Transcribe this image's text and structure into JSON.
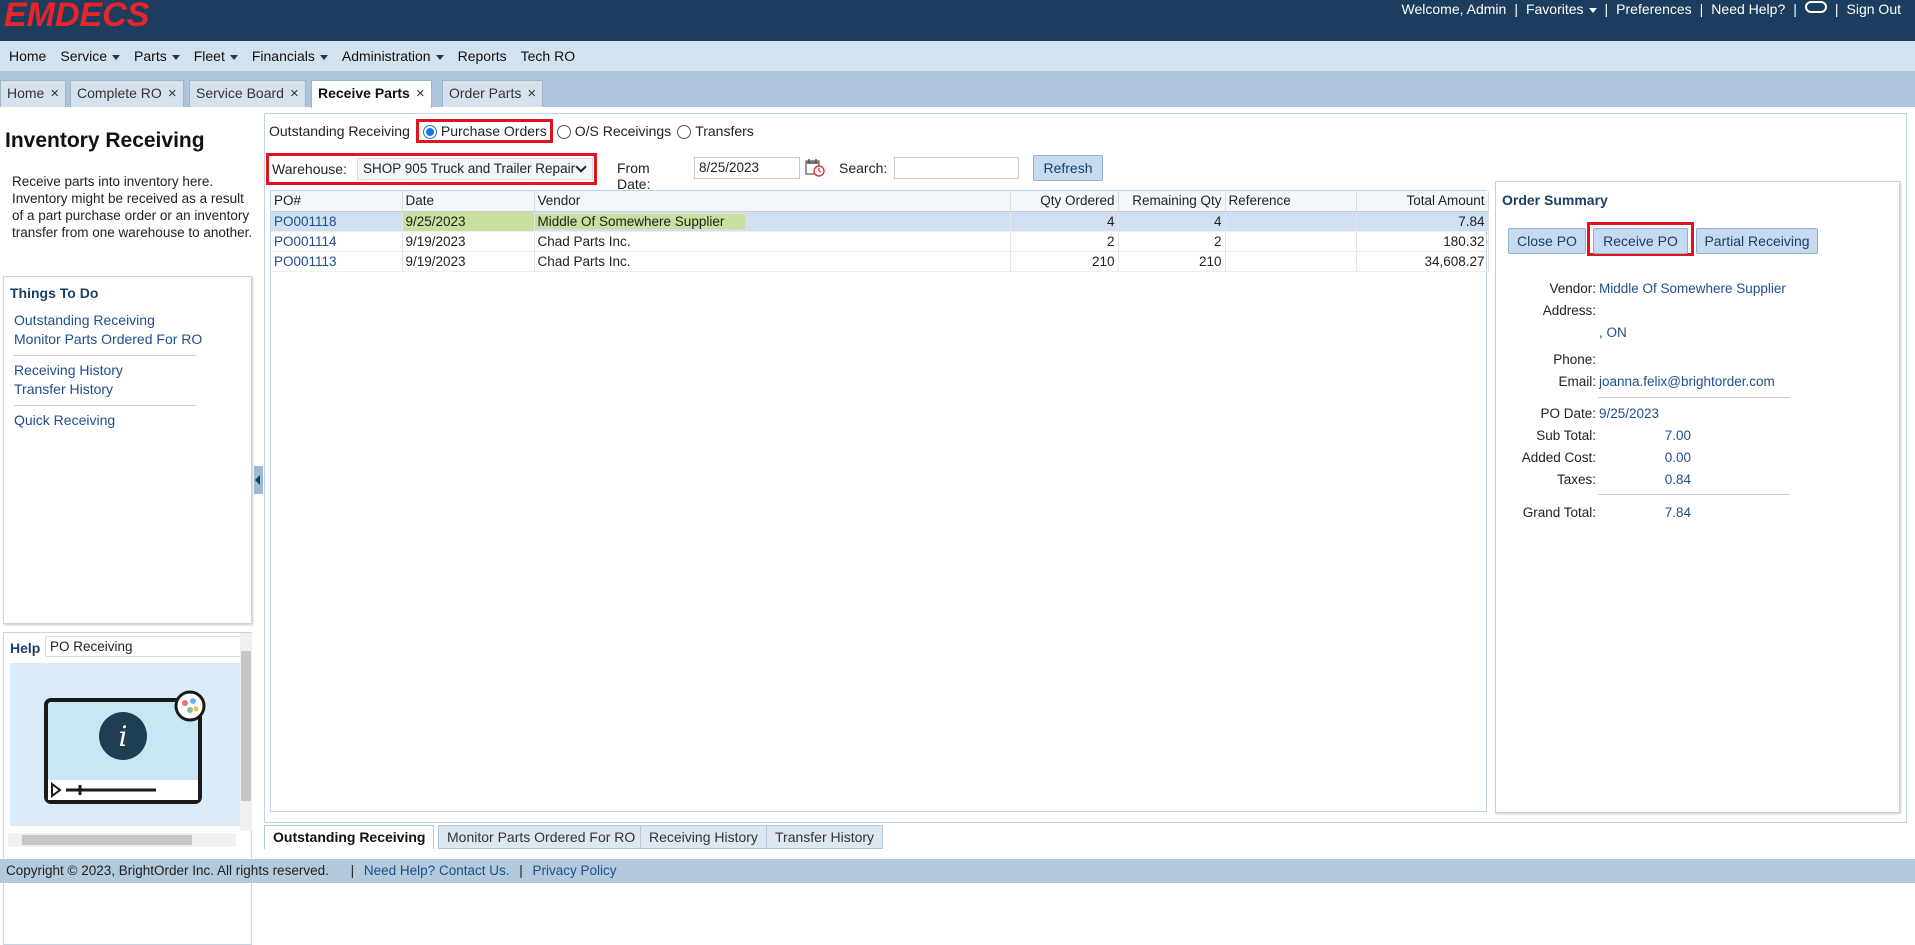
{
  "app": {
    "logo_text": "EMDECS",
    "brand_color": "#e8252b",
    "topbar_color": "#1d3d5f"
  },
  "top_nav": {
    "welcome": "Welcome, Admin",
    "favorites": "Favorites",
    "preferences": "Preferences",
    "need_help": "Need Help?",
    "sign_out": "Sign Out",
    "sep": "|"
  },
  "main_menu": {
    "home": "Home",
    "service": "Service",
    "parts": "Parts",
    "fleet": "Fleet",
    "financials": "Financials",
    "administration": "Administration",
    "reports": "Reports",
    "tech_ro": "Tech RO"
  },
  "tabs": [
    {
      "label": "Home"
    },
    {
      "label": "Complete RO"
    },
    {
      "label": "Service Board"
    },
    {
      "label": "Receive Parts"
    },
    {
      "label": "Order Parts"
    }
  ],
  "tab_close": "×",
  "sidebar": {
    "title": "Inventory Receiving",
    "description": "Receive parts into inventory here. Inventory might be received as a result of a part purchase order or an inventory transfer from one warehouse to another.",
    "todo_title": "Things To Do",
    "links": {
      "outstanding": "Outstanding Receiving",
      "monitor": "Monitor Parts Ordered For RO",
      "history": "Receiving History",
      "transfer": "Transfer History",
      "quick": "Quick Receiving"
    },
    "help_label": "Help",
    "help_topic": "PO Receiving"
  },
  "filters": {
    "outstanding_label": "Outstanding Receiving",
    "radio_po": "Purchase Orders",
    "radio_os": "O/S Receivings",
    "radio_transfers": "Transfers",
    "selected_radio": "Purchase Orders",
    "warehouse_label": "Warehouse:",
    "warehouse_value": "SHOP 905 Truck and Trailer Repair",
    "from_date_label": "From Date:",
    "from_date_value": "8/25/2023",
    "search_label": "Search:",
    "search_value": "",
    "refresh": "Refresh"
  },
  "grid": {
    "columns": {
      "po": "PO#",
      "date": "Date",
      "vendor": "Vendor",
      "qty_ordered": "Qty Ordered",
      "remaining_qty": "Remaining Qty",
      "reference": "Reference",
      "total_amount": "Total Amount"
    },
    "rows": [
      {
        "po": "PO001118",
        "date": "9/25/2023",
        "vendor": "Middle Of Somewhere Supplier",
        "qty_ordered": "4",
        "remaining_qty": "4",
        "reference": "",
        "total_amount": "7.84"
      },
      {
        "po": "PO001114",
        "date": "9/19/2023",
        "vendor": "Chad Parts Inc.",
        "qty_ordered": "2",
        "remaining_qty": "2",
        "reference": "",
        "total_amount": "180.32"
      },
      {
        "po": "PO001113",
        "date": "9/19/2023",
        "vendor": "Chad Parts Inc.",
        "qty_ordered": "210",
        "remaining_qty": "210",
        "reference": "",
        "total_amount": "34,608.27"
      }
    ]
  },
  "summary": {
    "title": "Order Summary",
    "close_po": "Close PO",
    "receive_po": "Receive PO",
    "partial": "Partial Receiving",
    "vendor_label": "Vendor:",
    "vendor": "Middle Of Somewhere Supplier",
    "address_label": "Address:",
    "address_line": ", ON",
    "phone_label": "Phone:",
    "email_label": "Email:",
    "email": "joanna.felix@brightorder.com",
    "po_date_label": "PO Date:",
    "po_date": "9/25/2023",
    "sub_total_label": "Sub Total:",
    "sub_total": "7.00",
    "added_cost_label": "Added Cost:",
    "added_cost": "0.00",
    "taxes_label": "Taxes:",
    "taxes": "0.84",
    "grand_total_label": "Grand Total:",
    "grand_total": "7.84"
  },
  "bottom_tabs": {
    "outstanding": "Outstanding Receiving",
    "monitor": "Monitor Parts Ordered For RO",
    "history": "Receiving History",
    "transfer": "Transfer History"
  },
  "footer": {
    "copyright": "Copyright © 2023, BrightOrder Inc. All rights reserved.",
    "sep": "|",
    "help": "Need Help? Contact Us.",
    "privacy": "Privacy Policy"
  }
}
